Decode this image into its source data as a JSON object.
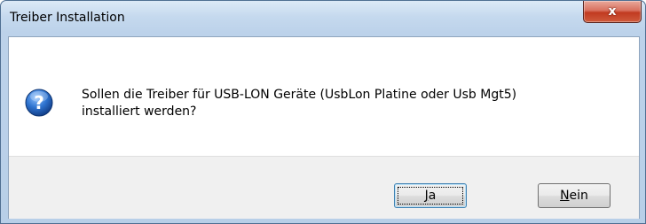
{
  "window": {
    "title": "Treiber Installation"
  },
  "close_button": {
    "symbol": "x"
  },
  "dialog": {
    "icon": "question-icon",
    "message_line1": "Sollen die Treiber für USB-LON Geräte (UsbLon Platine oder Usb Mgt5)",
    "message_line2": "installiert werden?"
  },
  "buttons": {
    "yes": {
      "mnemonic": "J",
      "rest": "a"
    },
    "no": {
      "mnemonic": "N",
      "rest": "ein"
    }
  },
  "colors": {
    "accent_icon": "#1f5fb8",
    "close": "#c13a21"
  }
}
